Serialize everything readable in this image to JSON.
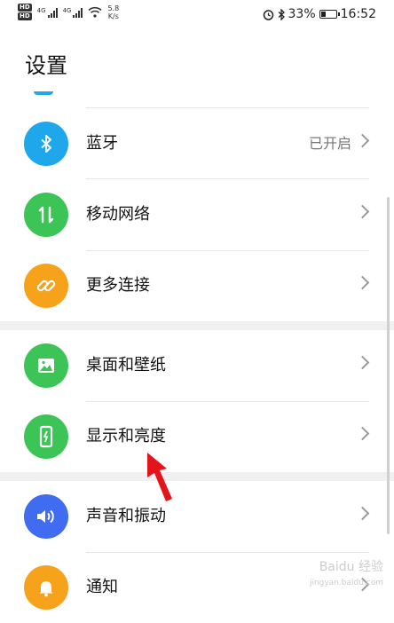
{
  "status_bar": {
    "hd1": "HD",
    "hd2": "HD",
    "net1": "4G",
    "net2": "4G",
    "speed_value": "5.8",
    "speed_unit": "K/s",
    "battery_text": "33%",
    "battery_level": 0.33,
    "time": "16:52"
  },
  "header": {
    "title": "设置"
  },
  "settings": [
    {
      "label": "蓝牙",
      "status": "已开启",
      "icon": "bluetooth-icon",
      "color": "#1ea7ea"
    },
    {
      "label": "移动网络",
      "status": "",
      "icon": "mobile-data-icon",
      "color": "#3cc457"
    },
    {
      "label": "更多连接",
      "status": "",
      "icon": "link-icon",
      "color": "#f7a21b"
    },
    {
      "label": "桌面和壁纸",
      "status": "",
      "icon": "wallpaper-icon",
      "color": "#3cc457"
    },
    {
      "label": "显示和亮度",
      "status": "",
      "icon": "display-icon",
      "color": "#3cc457"
    },
    {
      "label": "声音和振动",
      "status": "",
      "icon": "sound-icon",
      "color": "#3f6cf0"
    },
    {
      "label": "通知",
      "status": "",
      "icon": "bell-icon",
      "color": "#f7a21b"
    }
  ],
  "watermark": {
    "line1": "Baidu 经验",
    "line2": "jingyan.baidu.com"
  }
}
